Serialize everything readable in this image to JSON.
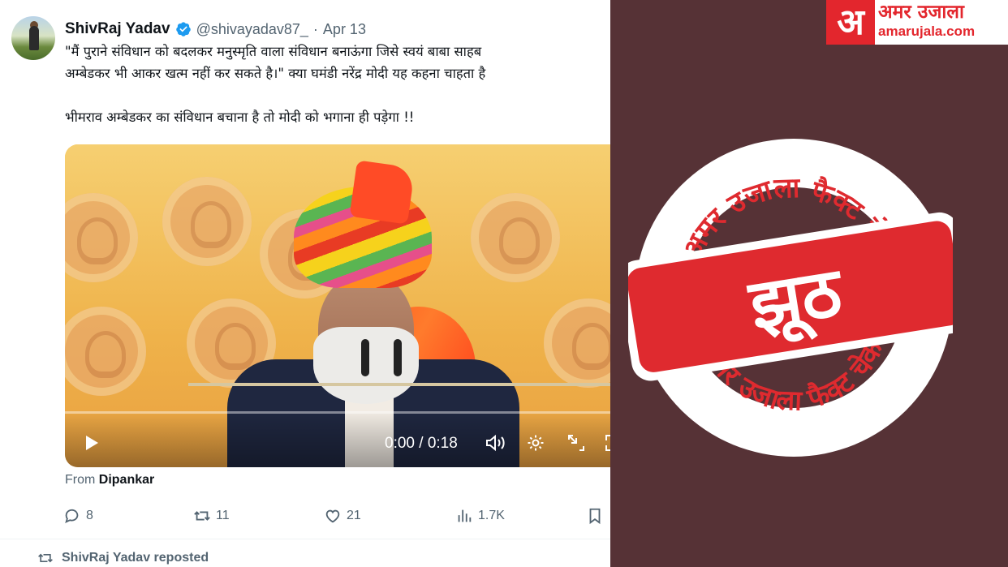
{
  "tweet": {
    "author_name": "ShivRaj Yadav",
    "handle": "@shivayadav87_",
    "separator": "·",
    "date": "Apr 13",
    "text_line1": "\"मैं पुराने संविधान को बदलकर मनुस्मृति वाला संविधान बनाऊंगा जिसे स्वयं बाबा साहब",
    "text_line2": "अम्बेडकर भी आकर खत्म नहीं कर सकते है।\" क्या घमंडी नरेंद्र मोदी यह कहना चाहता है",
    "text_line3": "भीमराव अम्बेडकर का संविधान बचाना है तो मोदी को भगाना ही पड़ेगा !!",
    "video": {
      "time": "0:00 / 0:18",
      "progress_fraction": 0
    },
    "from_prefix": "From",
    "from_name": "Dipankar",
    "actions": {
      "replies": "8",
      "reposts": "11",
      "likes": "21",
      "views": "1.7K"
    },
    "reposted_by": "ShivRaj Yadav reposted"
  },
  "panel": {
    "logo_mark": "अ",
    "logo_name": "अमर उजाला",
    "logo_url": "amarujala.com",
    "stamp_top_text": "अमर उजाला फैक्ट चेक",
    "stamp_bottom_text": "अमर उजाला फैक्ट चेक",
    "verdict": "झूठ",
    "colors": {
      "panel_bg": "#563236",
      "stamp_red": "#df2a2f",
      "logo_red": "#e3262d"
    }
  }
}
